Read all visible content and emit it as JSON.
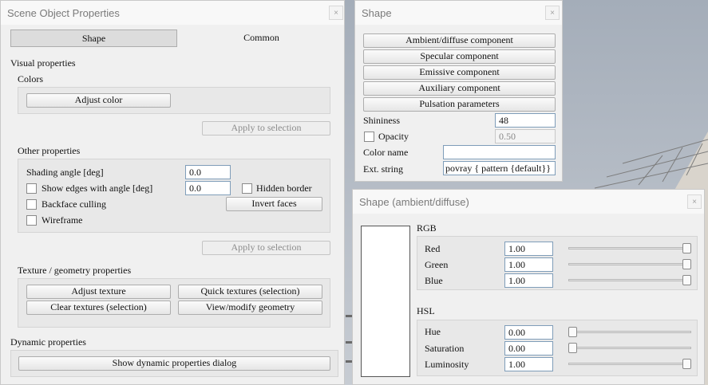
{
  "scene_object_props": {
    "title": "Scene Object Properties",
    "close_glyph": "×",
    "tabs": [
      {
        "label": "Shape",
        "active": true
      },
      {
        "label": "Common",
        "active": false
      }
    ],
    "visual_heading": "Visual properties",
    "colors_heading": "Colors",
    "adjust_color": "Adjust color",
    "apply_selection_1": "Apply to selection",
    "other_heading": "Other properties",
    "shading_label": "Shading angle [deg]",
    "shading_value": "0.0",
    "show_edges_label": "Show edges with angle [deg]",
    "show_edges_value": "0.0",
    "hidden_border_label": "Hidden border",
    "backface_label": "Backface culling",
    "invert_faces": "Invert faces",
    "wireframe_label": "Wireframe",
    "apply_selection_2": "Apply to selection",
    "texture_heading": "Texture / geometry properties",
    "adjust_texture": "Adjust texture",
    "quick_textures": "Quick textures (selection)",
    "clear_textures": "Clear textures (selection)",
    "view_geometry": "View/modify geometry",
    "dynamic_heading": "Dynamic properties",
    "show_dynamic": "Show dynamic properties dialog"
  },
  "shape_dialog": {
    "title": "Shape",
    "close_glyph": "×",
    "buttons": [
      "Ambient/diffuse component",
      "Specular component",
      "Emissive component",
      "Auxiliary component",
      "Pulsation parameters"
    ],
    "shininess_label": "Shininess",
    "shininess_value": "48",
    "opacity_label": "Opacity",
    "opacity_value": "0.50",
    "color_name_label": "Color name",
    "color_name_value": "",
    "ext_string_label": "Ext. string",
    "ext_string_value": "povray { pattern {default}}"
  },
  "ambient_dialog": {
    "title": "Shape (ambient/diffuse)",
    "close_glyph": "×",
    "swatch_color": "#ffffff",
    "rgb_heading": "RGB",
    "rgb": [
      {
        "label": "Red",
        "value": "1.00",
        "level": 1.0
      },
      {
        "label": "Green",
        "value": "1.00",
        "level": 1.0
      },
      {
        "label": "Blue",
        "value": "1.00",
        "level": 1.0
      }
    ],
    "hsl_heading": "HSL",
    "hsl": [
      {
        "label": "Hue",
        "value": "0.00",
        "level": 0.0
      },
      {
        "label": "Saturation",
        "value": "0.00",
        "level": 0.0
      },
      {
        "label": "Luminosity",
        "value": "1.00",
        "level": 1.0
      }
    ]
  }
}
